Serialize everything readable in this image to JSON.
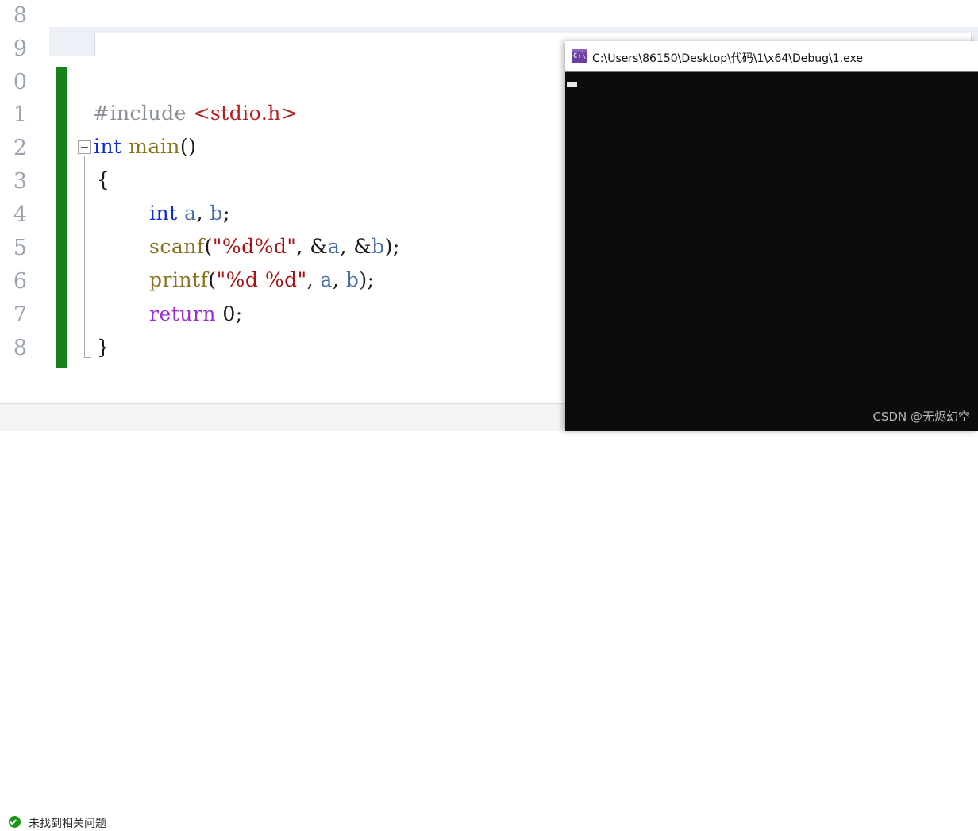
{
  "editor": {
    "nav_bar": {
      "value": "",
      "placeholder": ""
    },
    "line_numbers": [
      "8",
      "9",
      "0",
      "1",
      "2",
      "3",
      "4",
      "5",
      "6",
      "7",
      "8"
    ],
    "code_lines": [
      {
        "indent": 0,
        "tokens": [
          {
            "text": "#include ",
            "cls": "tk-pre"
          },
          {
            "text": "<stdio.h>",
            "cls": "tk-header"
          }
        ]
      },
      {
        "indent": 0,
        "tokens": [
          {
            "text": "int",
            "cls": "tk-kw"
          },
          {
            "text": " ",
            "cls": "tk-plain"
          },
          {
            "text": "main",
            "cls": "tk-fn"
          },
          {
            "text": "()",
            "cls": "tk-plain"
          }
        ]
      },
      {
        "indent": 0,
        "tokens": [
          {
            "text": "{",
            "cls": "tk-plain"
          }
        ]
      },
      {
        "indent": 0,
        "tokens": [
          {
            "text": "int",
            "cls": "tk-kw"
          },
          {
            "text": " ",
            "cls": "tk-plain"
          },
          {
            "text": "a",
            "cls": "tk-var"
          },
          {
            "text": ", ",
            "cls": "tk-plain"
          },
          {
            "text": "b",
            "cls": "tk-var"
          },
          {
            "text": ";",
            "cls": "tk-plain"
          }
        ]
      },
      {
        "indent": 0,
        "tokens": [
          {
            "text": "scanf",
            "cls": "tk-fn"
          },
          {
            "text": "(",
            "cls": "tk-plain"
          },
          {
            "text": "\"%d%d\"",
            "cls": "tk-str"
          },
          {
            "text": ", &",
            "cls": "tk-plain"
          },
          {
            "text": "a",
            "cls": "tk-var"
          },
          {
            "text": ", &",
            "cls": "tk-plain"
          },
          {
            "text": "b",
            "cls": "tk-var"
          },
          {
            "text": ");",
            "cls": "tk-plain"
          }
        ]
      },
      {
        "indent": 0,
        "tokens": [
          {
            "text": "printf",
            "cls": "tk-fn"
          },
          {
            "text": "(",
            "cls": "tk-plain"
          },
          {
            "text": "\"%d %d\"",
            "cls": "tk-str"
          },
          {
            "text": ", ",
            "cls": "tk-plain"
          },
          {
            "text": "a",
            "cls": "tk-var"
          },
          {
            "text": ", ",
            "cls": "tk-plain"
          },
          {
            "text": "b",
            "cls": "tk-var"
          },
          {
            "text": ");",
            "cls": "tk-plain"
          }
        ]
      },
      {
        "indent": 0,
        "tokens": [
          {
            "text": "return",
            "cls": "tk-ctl"
          },
          {
            "text": " 0;",
            "cls": "tk-plain"
          }
        ]
      },
      {
        "indent": 0,
        "tokens": [
          {
            "text": "}",
            "cls": "tk-plain"
          }
        ]
      }
    ],
    "fold_marker": "−",
    "change_bar_color": "#17821a"
  },
  "status_bar": {
    "icon": "success-check-icon",
    "text": "未找到相关问题",
    "icon_color": "#1a9618"
  },
  "console": {
    "icon": "console-app-icon",
    "icon_glyph": "C:\\",
    "title": "C:\\Users\\86150\\Desktop\\代码\\1\\x64\\Debug\\1.exe",
    "output": "",
    "cursor_visible": true,
    "background": "#0c0c0c"
  },
  "watermark": {
    "text": "CSDN @无烬幻空"
  }
}
